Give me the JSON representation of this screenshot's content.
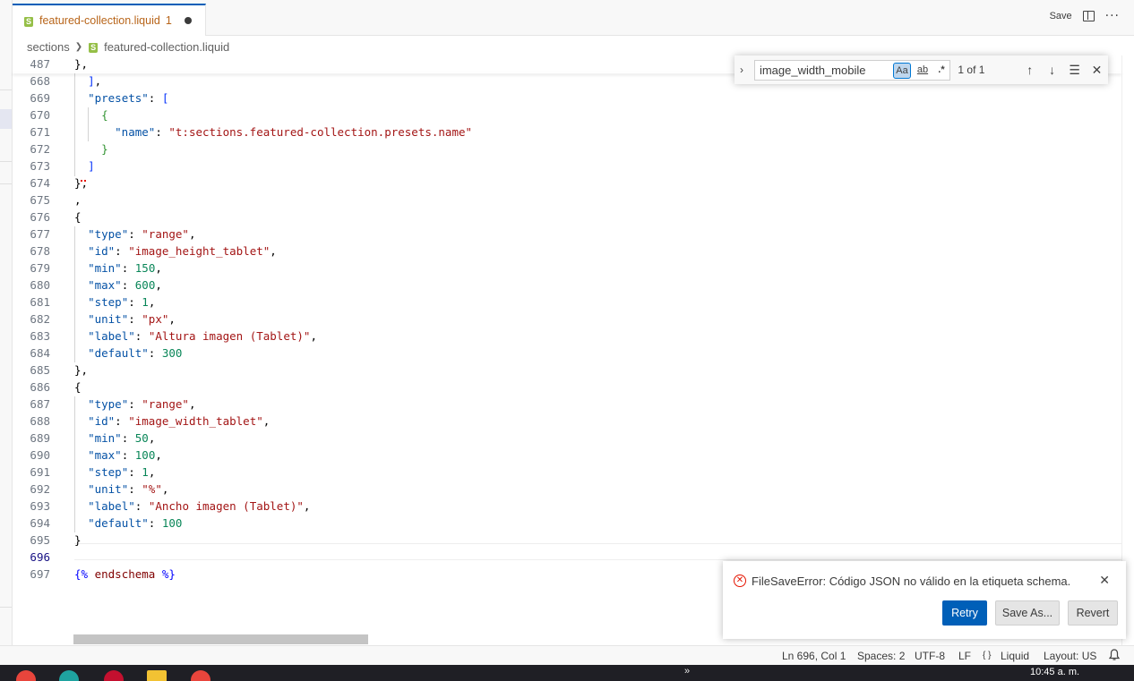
{
  "tab": {
    "filename": "featured-collection.liquid",
    "problem_count": "1",
    "save_label": "Save"
  },
  "breadcrumb": {
    "folder": "sections",
    "file": "featured-collection.liquid"
  },
  "find": {
    "query": "image_width_mobile",
    "match_case_label": "Aa",
    "whole_word_label": "ab",
    "regex_label": ".*",
    "count": "1 of 1"
  },
  "editor": {
    "lines": [
      {
        "n": "487",
        "code": "},"
      },
      {
        "n": "668",
        "code": "  ],"
      },
      {
        "n": "669",
        "code": "  \"presets\": ["
      },
      {
        "n": "670",
        "code": "    {"
      },
      {
        "n": "671",
        "code": "      \"name\": \"t:sections.featured-collection.presets.name\""
      },
      {
        "n": "672",
        "code": "    }"
      },
      {
        "n": "673",
        "code": "  ]"
      },
      {
        "n": "674",
        "code": "},"
      },
      {
        "n": "675",
        "code": ","
      },
      {
        "n": "676",
        "code": "{"
      },
      {
        "n": "677",
        "code": "  \"type\": \"range\","
      },
      {
        "n": "678",
        "code": "  \"id\": \"image_height_tablet\","
      },
      {
        "n": "679",
        "code": "  \"min\": 150,"
      },
      {
        "n": "680",
        "code": "  \"max\": 600,"
      },
      {
        "n": "681",
        "code": "  \"step\": 1,"
      },
      {
        "n": "682",
        "code": "  \"unit\": \"px\","
      },
      {
        "n": "683",
        "code": "  \"label\": \"Altura imagen (Tablet)\","
      },
      {
        "n": "684",
        "code": "  \"default\": 300"
      },
      {
        "n": "685",
        "code": "},"
      },
      {
        "n": "686",
        "code": "{"
      },
      {
        "n": "687",
        "code": "  \"type\": \"range\","
      },
      {
        "n": "688",
        "code": "  \"id\": \"image_width_tablet\","
      },
      {
        "n": "689",
        "code": "  \"min\": 50,"
      },
      {
        "n": "690",
        "code": "  \"max\": 100,"
      },
      {
        "n": "691",
        "code": "  \"step\": 1,"
      },
      {
        "n": "692",
        "code": "  \"unit\": \"%\","
      },
      {
        "n": "693",
        "code": "  \"label\": \"Ancho imagen (Tablet)\","
      },
      {
        "n": "694",
        "code": "  \"default\": 100"
      },
      {
        "n": "695",
        "code": "}"
      },
      {
        "n": "696",
        "code": ""
      },
      {
        "n": "697",
        "code": "{% endschema %}"
      }
    ],
    "active_line": "696"
  },
  "notification": {
    "message": "FileSaveError: Código JSON no válido en la etiqueta schema.",
    "retry": "Retry",
    "save_as": "Save As...",
    "revert": "Revert"
  },
  "statusbar": {
    "position": "Ln 696, Col 1",
    "spaces": "Spaces: 2",
    "encoding": "UTF-8",
    "eol": "LF",
    "language_icon": "{ }",
    "language": "Liquid",
    "layout": "Layout: US"
  },
  "taskbar": {
    "time": "10:45 a. m."
  },
  "colors": {
    "accent": "#005fb8",
    "error": "#e51400",
    "liquid_brand": "#95bf47",
    "tab_text": "#b8651a"
  }
}
